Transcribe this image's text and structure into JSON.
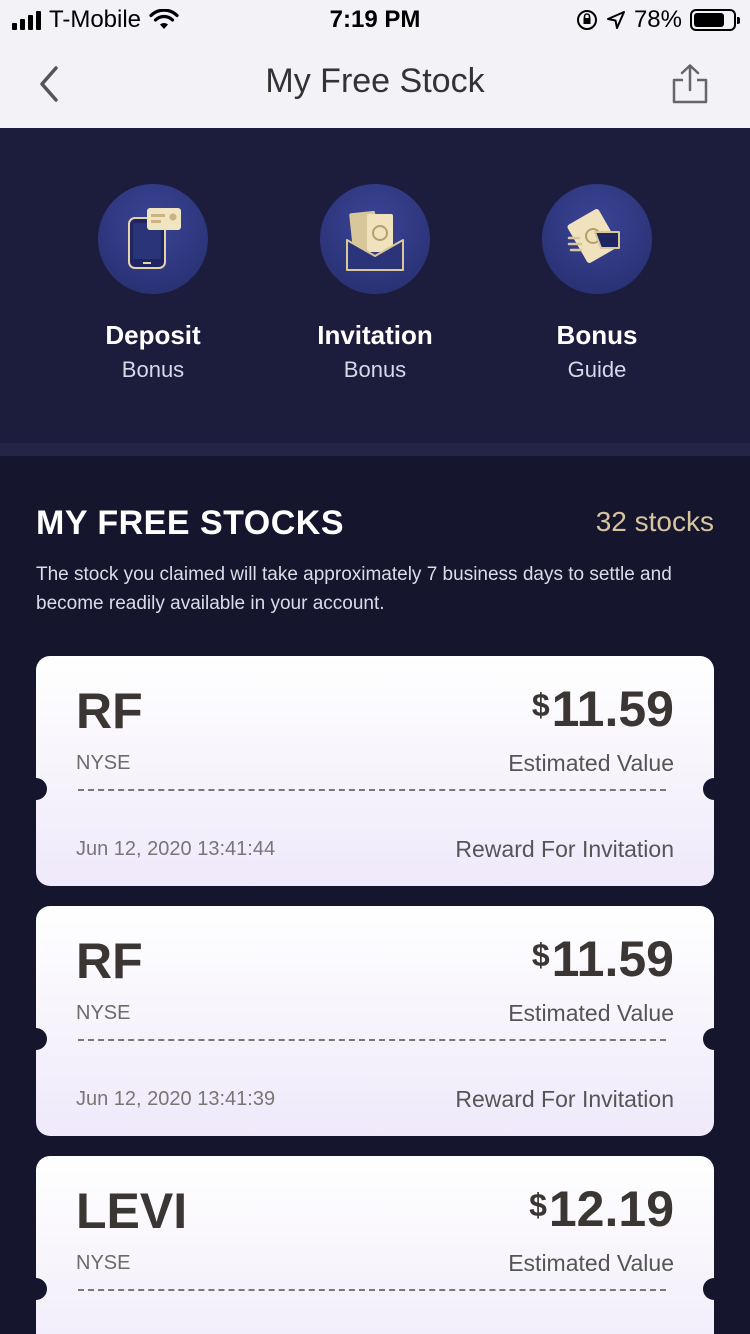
{
  "status_bar": {
    "carrier": "T-Mobile",
    "time": "7:19 PM",
    "battery": "78%",
    "battery_level": 0.78
  },
  "nav": {
    "title": "My Free Stock",
    "back_icon": "chevron-left-icon",
    "share_icon": "share-icon"
  },
  "features": [
    {
      "title": "Deposit",
      "subtitle": "Bonus",
      "icon": "phone-card-icon"
    },
    {
      "title": "Invitation",
      "subtitle": "Bonus",
      "icon": "envelope-cash-icon"
    },
    {
      "title": "Bonus",
      "subtitle": "Guide",
      "icon": "hand-cash-icon"
    }
  ],
  "section": {
    "title": "MY FREE STOCKS",
    "count": "32 stocks",
    "note": "The stock you claimed will take approximately 7 business days to settle and become readily available in your account."
  },
  "stocks": [
    {
      "symbol": "RF",
      "exchange": "NYSE",
      "currency": "$",
      "amount": "11.59",
      "value_label": "Estimated Value",
      "date": "Jun 12, 2020 13:41:44",
      "reason": "Reward For Invitation"
    },
    {
      "symbol": "RF",
      "exchange": "NYSE",
      "currency": "$",
      "amount": "11.59",
      "value_label": "Estimated Value",
      "date": "Jun 12, 2020 13:41:39",
      "reason": "Reward For Invitation"
    },
    {
      "symbol": "LEVI",
      "exchange": "NYSE",
      "currency": "$",
      "amount": "12.19",
      "value_label": "Estimated Value",
      "date": "",
      "reason": ""
    }
  ],
  "colors": {
    "background": "#15152e",
    "panel": "#1c1c3d",
    "accent_gold": "#d6c49d"
  }
}
